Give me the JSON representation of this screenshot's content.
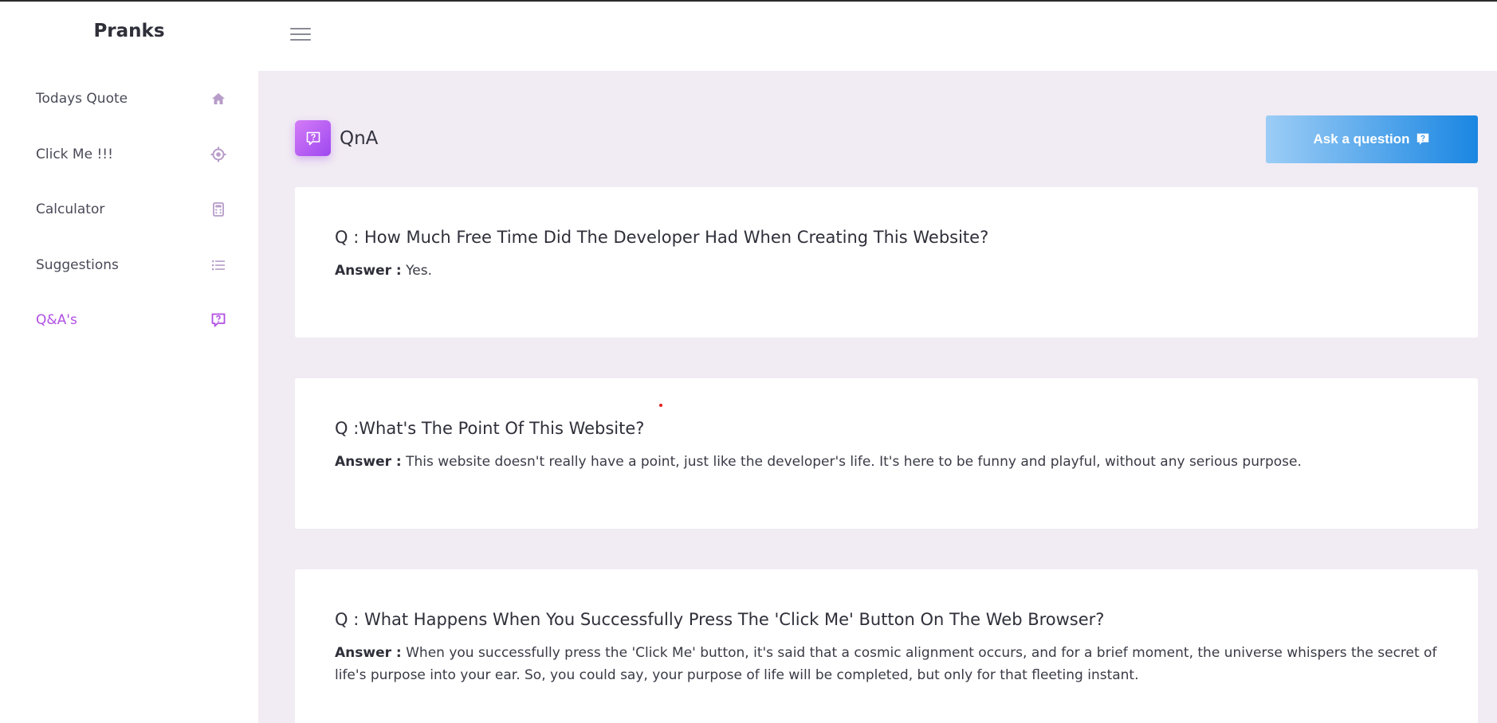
{
  "brand": "Pranks",
  "sidebar": {
    "items": [
      {
        "label": "Todays Quote",
        "icon": "home-icon"
      },
      {
        "label": "Click Me !!!",
        "icon": "target-icon"
      },
      {
        "label": "Calculator",
        "icon": "calculator-icon"
      },
      {
        "label": "Suggestions",
        "icon": "list-icon"
      },
      {
        "label": "Q&A's",
        "icon": "question-bubble-icon",
        "active": true
      }
    ]
  },
  "header": {
    "menu_icon": "hamburger-icon"
  },
  "page": {
    "title": "QnA",
    "title_icon": "question-bubble-icon",
    "ask_button_label": "Ask a question",
    "ask_button_icon": "question-bubble-icon"
  },
  "qna": [
    {
      "question": "Q : How Much Free Time Did The Developer Had When Creating This Website?",
      "answer_label": "Answer :",
      "answer": "Yes."
    },
    {
      "question": "Q :What's The Point Of This Website?",
      "answer_label": "Answer :",
      "answer": "This website doesn't really have a point, just like the developer's life. It's here to be funny and playful, without any serious purpose."
    },
    {
      "question": "Q : What Happens When You Successfully Press The 'Click Me' Button On The Web Browser?",
      "answer_label": "Answer :",
      "answer": "When you successfully press the 'Click Me' button, it's said that a cosmic alignment occurs, and for a brief moment, the universe whispers the secret of life's purpose into your ear. So, you could say, your purpose of life will be completed, but only for that fleeting instant."
    }
  ],
  "colors": {
    "accent": "#b14fe3",
    "icon_muted": "#b79cc9",
    "main_background": "#f1ebf3",
    "button_gradient_start": "#9ccdf6",
    "button_gradient_end": "#1a86e2"
  }
}
